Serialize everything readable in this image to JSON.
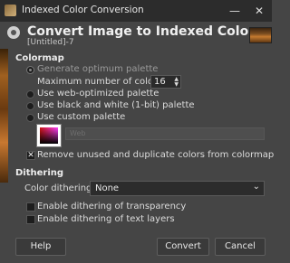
{
  "window": {
    "title": "Indexed Color Conversion",
    "minimize_glyph": "—",
    "close_glyph": "✕"
  },
  "header": {
    "title": "Convert Image to Indexed Colors",
    "subtitle": "[Untitled]-7"
  },
  "colormap": {
    "section_label": "Colormap",
    "generate_optimum": "Generate optimum palette",
    "max_colors_label": "Maximum number of colors:",
    "max_colors_value": "16",
    "web_optimized": "Use web-optimized palette",
    "black_white": "Use black and white (1-bit) palette",
    "custom_palette": "Use custom palette",
    "palette_name": "Web",
    "remove_unused": "Remove unused and duplicate colors from colormap",
    "remove_unused_checked": true,
    "selected_option": "generate_optimum"
  },
  "dithering": {
    "section_label": "Dithering",
    "color_dithering_label": "Color dithering:",
    "color_dithering_value": "None",
    "transparency": "Enable dithering of transparency",
    "text_layers": "Enable dithering of text layers"
  },
  "buttons": {
    "help": "Help",
    "convert": "Convert",
    "cancel": "Cancel"
  }
}
